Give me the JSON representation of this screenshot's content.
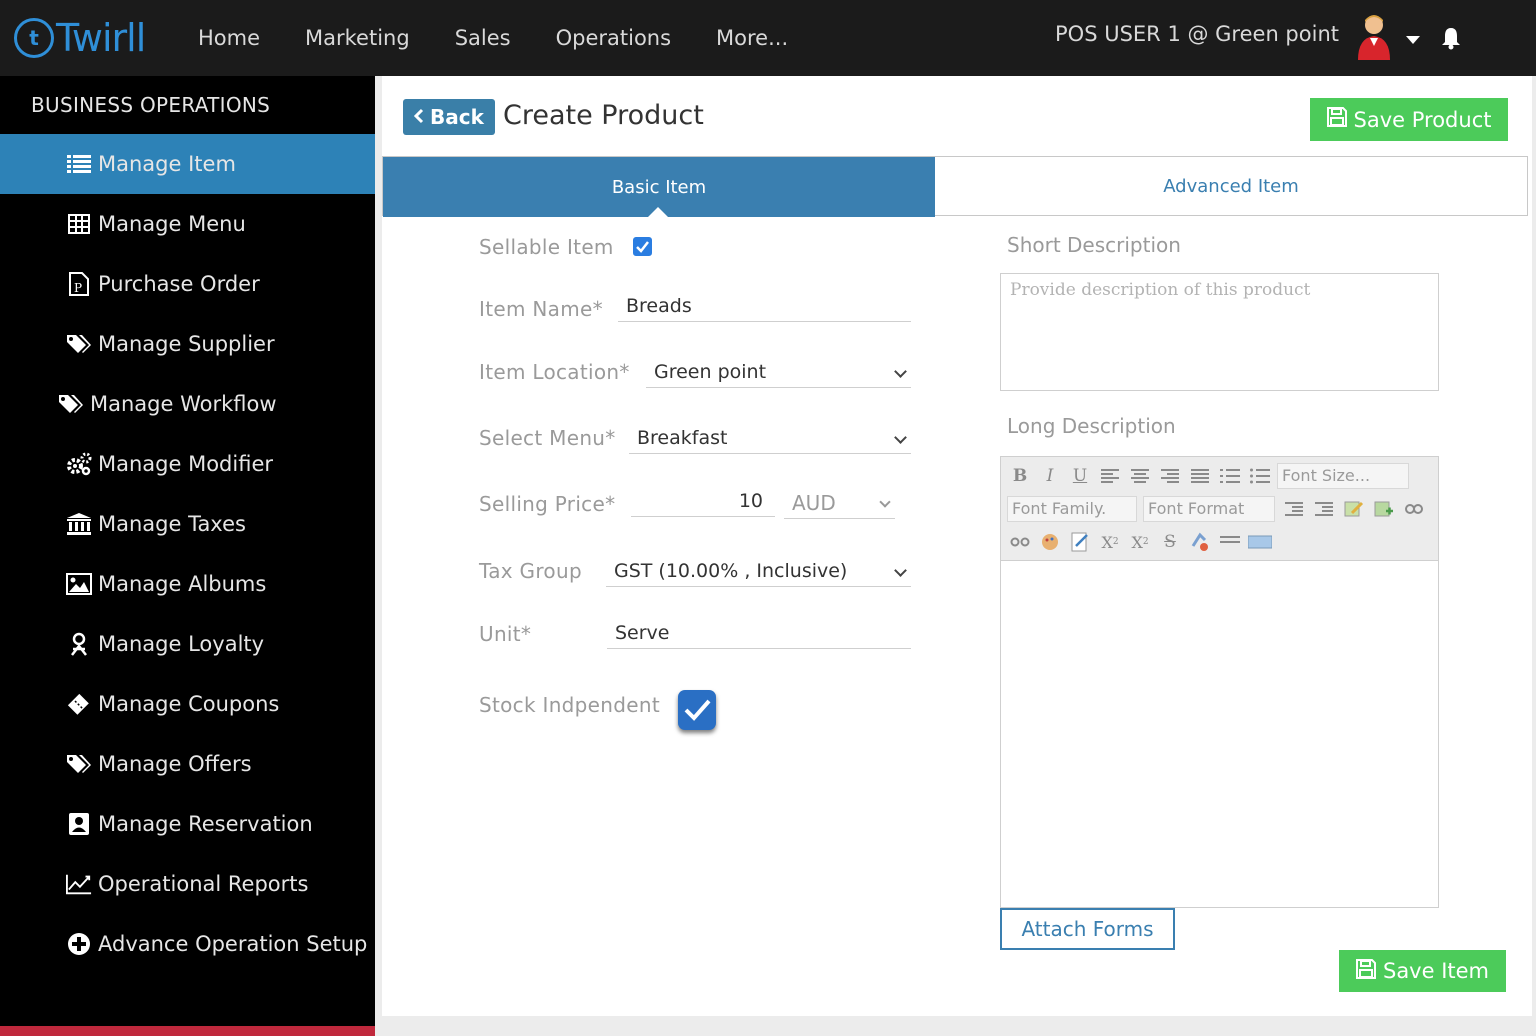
{
  "app": {
    "logo_text": "Twirll",
    "nav": [
      "Home",
      "Marketing",
      "Sales",
      "Operations",
      "More..."
    ],
    "user": "POS USER 1 @ Green point"
  },
  "sidebar": {
    "heading": "BUSINESS OPERATIONS",
    "items": [
      {
        "label": "Manage Item",
        "icon": "list-icon",
        "active": true
      },
      {
        "label": "Manage Menu",
        "icon": "grid-icon"
      },
      {
        "label": "Purchase Order",
        "icon": "document-p-icon"
      },
      {
        "label": "Manage Supplier",
        "icon": "tags-icon"
      },
      {
        "label": "Manage Workflow",
        "icon": "tags-icon"
      },
      {
        "label": "Manage Modifier",
        "icon": "gears-icon"
      },
      {
        "label": "Manage Taxes",
        "icon": "bank-icon"
      },
      {
        "label": "Manage Albums",
        "icon": "picture-icon"
      },
      {
        "label": "Manage Loyalty",
        "icon": "person-icon"
      },
      {
        "label": "Manage Coupons",
        "icon": "ticket-icon"
      },
      {
        "label": "Manage Offers",
        "icon": "tags-icon"
      },
      {
        "label": "Manage Reservation",
        "icon": "contact-icon"
      },
      {
        "label": "Operational Reports",
        "icon": "chart-icon"
      },
      {
        "label": "Advance Operation Setup",
        "icon": "plus-circle-icon"
      }
    ]
  },
  "page": {
    "back": "Back",
    "title": "Create Product",
    "save_product": "Save Product",
    "tabs": {
      "basic": "Basic Item",
      "advanced": "Advanced Item"
    }
  },
  "form": {
    "sellable_label": "Sellable Item",
    "sellable_checked": true,
    "item_name_label": "Item Name*",
    "item_name": "Breads",
    "location_label": "Item Location*",
    "location": "Green point",
    "menu_label": "Select Menu*",
    "menu": "Breakfast",
    "price_label": "Selling Price*",
    "price": "10",
    "currency": "AUD",
    "tax_label": "Tax Group",
    "tax": "GST (10.00% , Inclusive)",
    "unit_label": "Unit*",
    "unit": "Serve",
    "stock_label": "Stock Indpendent",
    "stock_checked": true
  },
  "descriptions": {
    "short_label": "Short Description",
    "short_placeholder": "Provide description of this product",
    "long_label": "Long Description",
    "font_size": "Font Size...",
    "font_family": "Font Family.",
    "font_format": "Font Format"
  },
  "actions": {
    "attach_forms": "Attach Forms",
    "save_item": "Save Item"
  },
  "colors": {
    "accent": "#2d82b7",
    "tab_active": "#3a7fb0",
    "save_green": "#4ccb5a",
    "topbar": "#1b1b1b"
  }
}
